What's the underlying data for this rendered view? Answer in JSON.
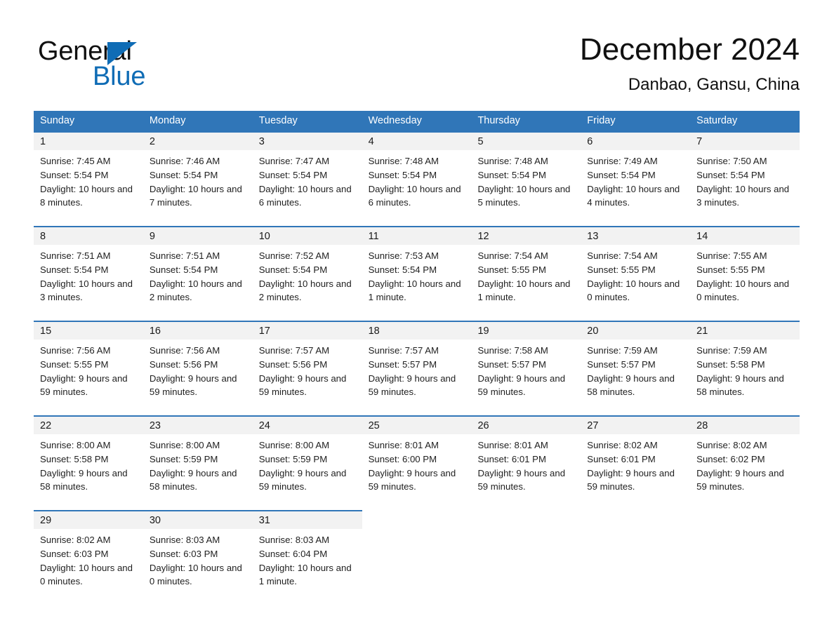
{
  "brand": {
    "name_part1": "General",
    "name_part2": "Blue",
    "triangle_color": "#0f6cb5",
    "text_color": "#101010"
  },
  "header": {
    "month_title": "December 2024",
    "location": "Danbao, Gansu, China"
  },
  "theme": {
    "header_blue": "#3076b8",
    "daynum_bg": "#f2f2f2",
    "cell_bg": "#ffffff",
    "text": "#1a1a1a"
  },
  "weekdays": [
    "Sunday",
    "Monday",
    "Tuesday",
    "Wednesday",
    "Thursday",
    "Friday",
    "Saturday"
  ],
  "weeks": [
    [
      {
        "day": "1",
        "sunrise": "Sunrise: 7:45 AM",
        "sunset": "Sunset: 5:54 PM",
        "daylight": "Daylight: 10 hours and 8 minutes."
      },
      {
        "day": "2",
        "sunrise": "Sunrise: 7:46 AM",
        "sunset": "Sunset: 5:54 PM",
        "daylight": "Daylight: 10 hours and 7 minutes."
      },
      {
        "day": "3",
        "sunrise": "Sunrise: 7:47 AM",
        "sunset": "Sunset: 5:54 PM",
        "daylight": "Daylight: 10 hours and 6 minutes."
      },
      {
        "day": "4",
        "sunrise": "Sunrise: 7:48 AM",
        "sunset": "Sunset: 5:54 PM",
        "daylight": "Daylight: 10 hours and 6 minutes."
      },
      {
        "day": "5",
        "sunrise": "Sunrise: 7:48 AM",
        "sunset": "Sunset: 5:54 PM",
        "daylight": "Daylight: 10 hours and 5 minutes."
      },
      {
        "day": "6",
        "sunrise": "Sunrise: 7:49 AM",
        "sunset": "Sunset: 5:54 PM",
        "daylight": "Daylight: 10 hours and 4 minutes."
      },
      {
        "day": "7",
        "sunrise": "Sunrise: 7:50 AM",
        "sunset": "Sunset: 5:54 PM",
        "daylight": "Daylight: 10 hours and 3 minutes."
      }
    ],
    [
      {
        "day": "8",
        "sunrise": "Sunrise: 7:51 AM",
        "sunset": "Sunset: 5:54 PM",
        "daylight": "Daylight: 10 hours and 3 minutes."
      },
      {
        "day": "9",
        "sunrise": "Sunrise: 7:51 AM",
        "sunset": "Sunset: 5:54 PM",
        "daylight": "Daylight: 10 hours and 2 minutes."
      },
      {
        "day": "10",
        "sunrise": "Sunrise: 7:52 AM",
        "sunset": "Sunset: 5:54 PM",
        "daylight": "Daylight: 10 hours and 2 minutes."
      },
      {
        "day": "11",
        "sunrise": "Sunrise: 7:53 AM",
        "sunset": "Sunset: 5:54 PM",
        "daylight": "Daylight: 10 hours and 1 minute."
      },
      {
        "day": "12",
        "sunrise": "Sunrise: 7:54 AM",
        "sunset": "Sunset: 5:55 PM",
        "daylight": "Daylight: 10 hours and 1 minute."
      },
      {
        "day": "13",
        "sunrise": "Sunrise: 7:54 AM",
        "sunset": "Sunset: 5:55 PM",
        "daylight": "Daylight: 10 hours and 0 minutes."
      },
      {
        "day": "14",
        "sunrise": "Sunrise: 7:55 AM",
        "sunset": "Sunset: 5:55 PM",
        "daylight": "Daylight: 10 hours and 0 minutes."
      }
    ],
    [
      {
        "day": "15",
        "sunrise": "Sunrise: 7:56 AM",
        "sunset": "Sunset: 5:55 PM",
        "daylight": "Daylight: 9 hours and 59 minutes."
      },
      {
        "day": "16",
        "sunrise": "Sunrise: 7:56 AM",
        "sunset": "Sunset: 5:56 PM",
        "daylight": "Daylight: 9 hours and 59 minutes."
      },
      {
        "day": "17",
        "sunrise": "Sunrise: 7:57 AM",
        "sunset": "Sunset: 5:56 PM",
        "daylight": "Daylight: 9 hours and 59 minutes."
      },
      {
        "day": "18",
        "sunrise": "Sunrise: 7:57 AM",
        "sunset": "Sunset: 5:57 PM",
        "daylight": "Daylight: 9 hours and 59 minutes."
      },
      {
        "day": "19",
        "sunrise": "Sunrise: 7:58 AM",
        "sunset": "Sunset: 5:57 PM",
        "daylight": "Daylight: 9 hours and 59 minutes."
      },
      {
        "day": "20",
        "sunrise": "Sunrise: 7:59 AM",
        "sunset": "Sunset: 5:57 PM",
        "daylight": "Daylight: 9 hours and 58 minutes."
      },
      {
        "day": "21",
        "sunrise": "Sunrise: 7:59 AM",
        "sunset": "Sunset: 5:58 PM",
        "daylight": "Daylight: 9 hours and 58 minutes."
      }
    ],
    [
      {
        "day": "22",
        "sunrise": "Sunrise: 8:00 AM",
        "sunset": "Sunset: 5:58 PM",
        "daylight": "Daylight: 9 hours and 58 minutes."
      },
      {
        "day": "23",
        "sunrise": "Sunrise: 8:00 AM",
        "sunset": "Sunset: 5:59 PM",
        "daylight": "Daylight: 9 hours and 58 minutes."
      },
      {
        "day": "24",
        "sunrise": "Sunrise: 8:00 AM",
        "sunset": "Sunset: 5:59 PM",
        "daylight": "Daylight: 9 hours and 59 minutes."
      },
      {
        "day": "25",
        "sunrise": "Sunrise: 8:01 AM",
        "sunset": "Sunset: 6:00 PM",
        "daylight": "Daylight: 9 hours and 59 minutes."
      },
      {
        "day": "26",
        "sunrise": "Sunrise: 8:01 AM",
        "sunset": "Sunset: 6:01 PM",
        "daylight": "Daylight: 9 hours and 59 minutes."
      },
      {
        "day": "27",
        "sunrise": "Sunrise: 8:02 AM",
        "sunset": "Sunset: 6:01 PM",
        "daylight": "Daylight: 9 hours and 59 minutes."
      },
      {
        "day": "28",
        "sunrise": "Sunrise: 8:02 AM",
        "sunset": "Sunset: 6:02 PM",
        "daylight": "Daylight: 9 hours and 59 minutes."
      }
    ],
    [
      {
        "day": "29",
        "sunrise": "Sunrise: 8:02 AM",
        "sunset": "Sunset: 6:03 PM",
        "daylight": "Daylight: 10 hours and 0 minutes."
      },
      {
        "day": "30",
        "sunrise": "Sunrise: 8:03 AM",
        "sunset": "Sunset: 6:03 PM",
        "daylight": "Daylight: 10 hours and 0 minutes."
      },
      {
        "day": "31",
        "sunrise": "Sunrise: 8:03 AM",
        "sunset": "Sunset: 6:04 PM",
        "daylight": "Daylight: 10 hours and 1 minute."
      },
      {
        "day": "",
        "sunrise": "",
        "sunset": "",
        "daylight": ""
      },
      {
        "day": "",
        "sunrise": "",
        "sunset": "",
        "daylight": ""
      },
      {
        "day": "",
        "sunrise": "",
        "sunset": "",
        "daylight": ""
      },
      {
        "day": "",
        "sunrise": "",
        "sunset": "",
        "daylight": ""
      }
    ]
  ]
}
